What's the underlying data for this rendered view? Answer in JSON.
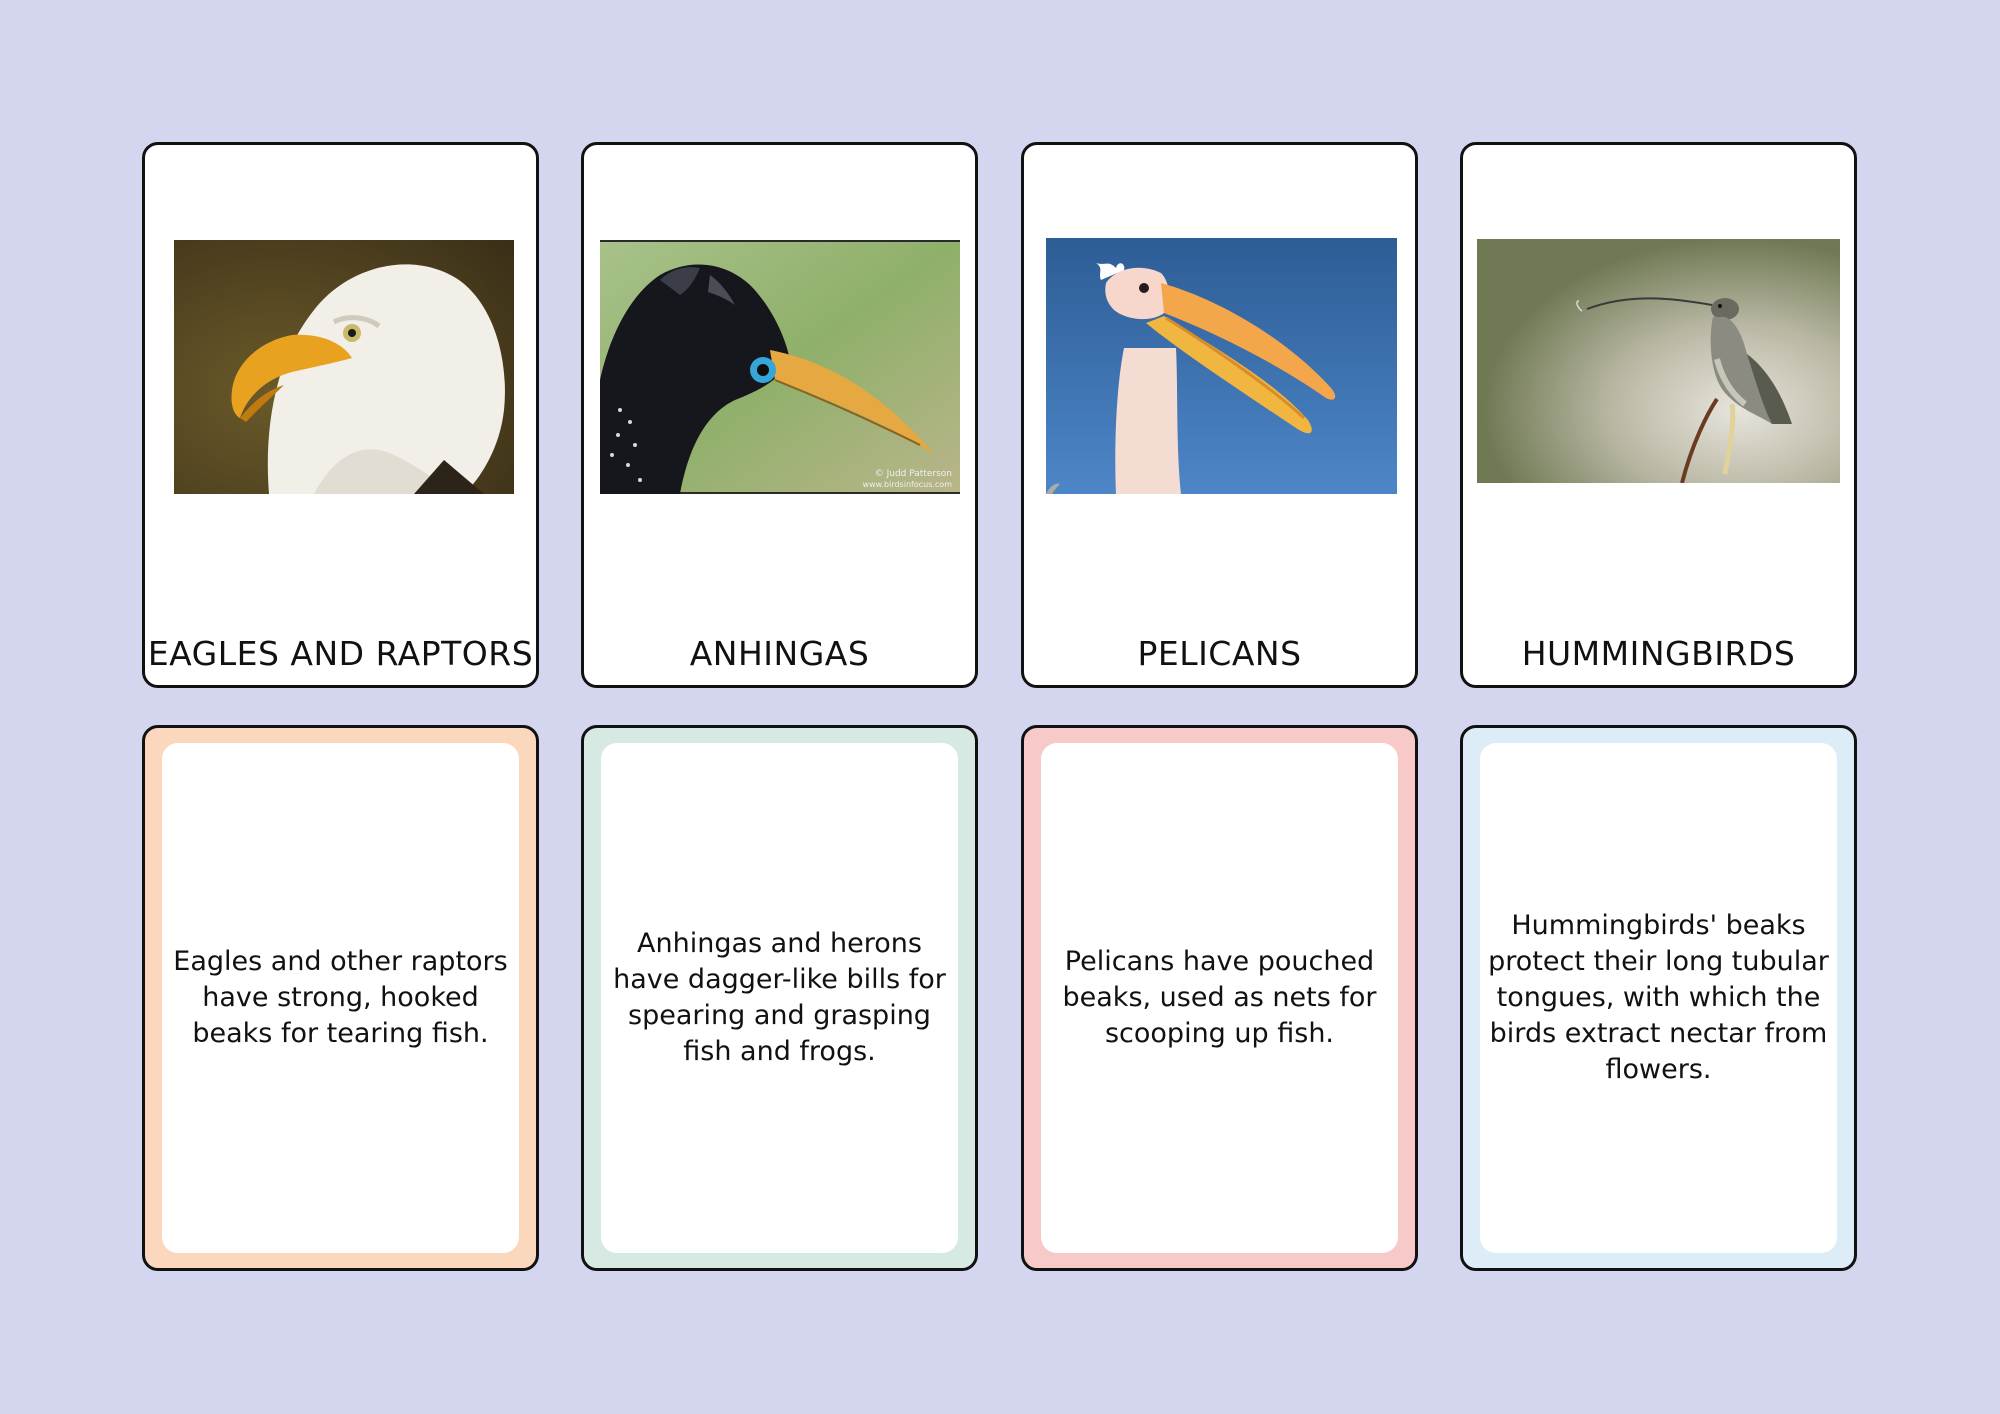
{
  "cards": [
    {
      "title": "EAGLES AND RAPTORS",
      "photo_subject": "bald-eagle-head",
      "description": "Eagles and other raptors have strong, hooked beaks for tearing fish.",
      "accent_color": "#fbd7bd"
    },
    {
      "title": "ANHINGAS",
      "photo_subject": "anhinga-head",
      "photo_watermark": "© Judd Patterson\nwww.birdsinfocus.com",
      "description": "Anhingas and herons have dagger-like bills for spearing and grasping fish and frogs.",
      "accent_color": "#d6e9e3"
    },
    {
      "title": "PELICANS",
      "photo_subject": "pelican-open-beak",
      "description": "Pelicans have pouched beaks, used as nets for scooping up fish.",
      "accent_color": "#f7cac9"
    },
    {
      "title": "HUMMINGBIRDS",
      "photo_subject": "hummingbird-perched",
      "description": "Hummingbirds' beaks protect their long tubular tongues, with which the birds extract nectar from flowers.",
      "accent_color": "#dcedf7"
    }
  ],
  "background_color": "#d4d5ee"
}
